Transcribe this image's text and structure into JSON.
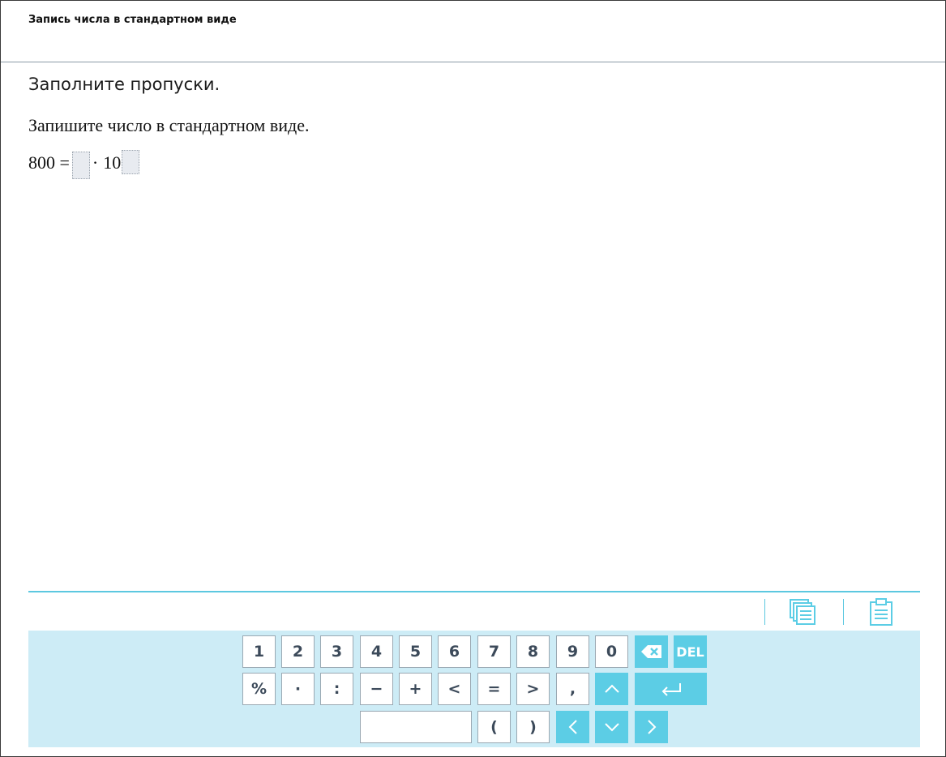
{
  "header": {
    "title": "Запись числа в стандартном виде"
  },
  "task": {
    "instruction": "Заполните пропуски.",
    "prompt": "Запишите число в стандартном виде.",
    "equation": {
      "lhs": "800 =",
      "dot": "·",
      "base": "10",
      "mantissa_value": "",
      "exponent_value": ""
    }
  },
  "toolbar": {
    "icons": [
      "copy-icon",
      "paste-icon"
    ]
  },
  "keyboard": {
    "row1": [
      "1",
      "2",
      "3",
      "4",
      "5",
      "6",
      "7",
      "8",
      "9",
      "0"
    ],
    "backspace_icon": "backspace-icon",
    "del_label": "DEL",
    "row2": [
      "%",
      "·",
      ":",
      "−",
      "+",
      "<",
      "=",
      ">",
      ","
    ],
    "up_icon": "arrow-up-icon",
    "enter_icon": "enter-icon",
    "space_label": "",
    "row3": [
      "(",
      ")"
    ],
    "left_icon": "arrow-left-icon",
    "down_icon": "arrow-down-icon",
    "right_icon": "arrow-right-icon"
  },
  "colors": {
    "accent": "#5ccde5",
    "keyboard_bg": "#cdecf6",
    "key_text": "#3c4a5a",
    "header_line": "#8a9aa6"
  }
}
